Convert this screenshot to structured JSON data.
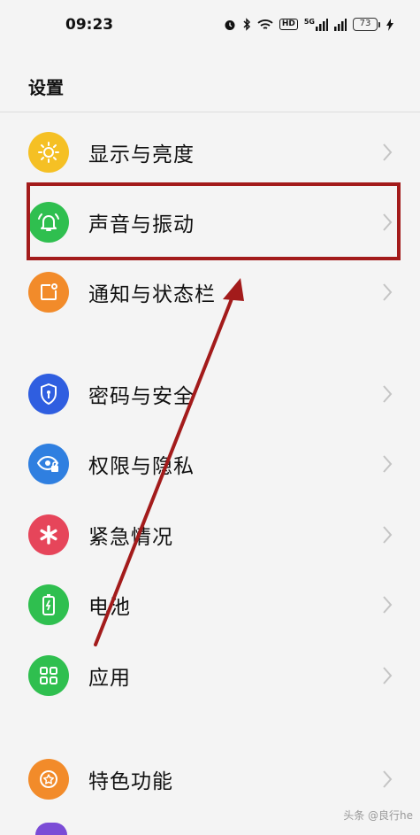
{
  "status_bar": {
    "time": "09:23",
    "network_label": "5G",
    "hd_label": "HD",
    "battery_level": "73"
  },
  "header": {
    "title": "设置"
  },
  "settings_items": [
    {
      "label": "显示与亮度",
      "icon": "sun-icon",
      "color": "#f5c024"
    },
    {
      "label": "声音与振动",
      "icon": "bell-icon",
      "color": "#2fbf4f"
    },
    {
      "label": "通知与状态栏",
      "icon": "notification-icon",
      "color": "#f28b2a"
    },
    {
      "label": "密码与安全",
      "icon": "shield-icon",
      "color": "#2f5ee0"
    },
    {
      "label": "权限与隐私",
      "icon": "eye-lock-icon",
      "color": "#2f7fe0"
    },
    {
      "label": "紧急情况",
      "icon": "asterisk-icon",
      "color": "#e6455a"
    },
    {
      "label": "电池",
      "icon": "battery-icon",
      "color": "#2fbf4f"
    },
    {
      "label": "应用",
      "icon": "grid-icon",
      "color": "#2fbf4f"
    },
    {
      "label": "特色功能",
      "icon": "star-icon",
      "color": "#f28b2a"
    }
  ],
  "annotation": {
    "highlight_color": "#a31b1b",
    "highlighted_item": "声音与振动"
  },
  "watermark": {
    "text": "头条 @良行he"
  }
}
